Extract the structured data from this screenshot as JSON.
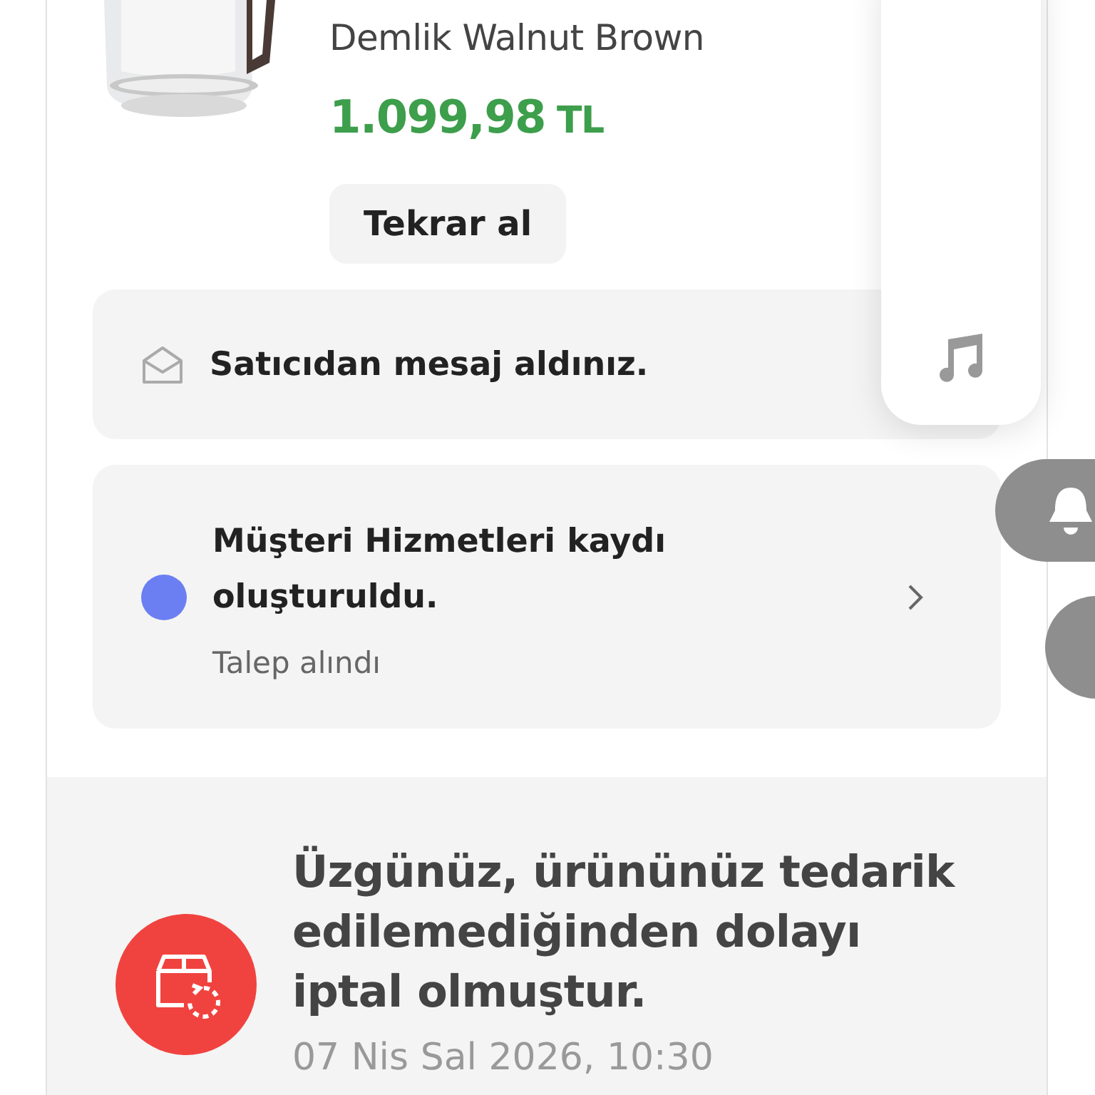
{
  "product": {
    "name": "Demlik Walnut Brown",
    "price": "1.099,98",
    "currency": "TL",
    "button": "Tekrar al"
  },
  "message_notice": {
    "text": "Satıcıdan mesaj aldınız."
  },
  "support_ticket": {
    "title": "Müşteri Hizmetleri kaydı oluşturuldu.",
    "status": "Talep alındı",
    "color": "#6b7ff2"
  },
  "cancellation": {
    "text": "Üzgünüz, ürününüz tedarik edilemediğinden dolayı iptal olmuştur.",
    "date": "07 Nis Sal 2026, 10:30"
  }
}
